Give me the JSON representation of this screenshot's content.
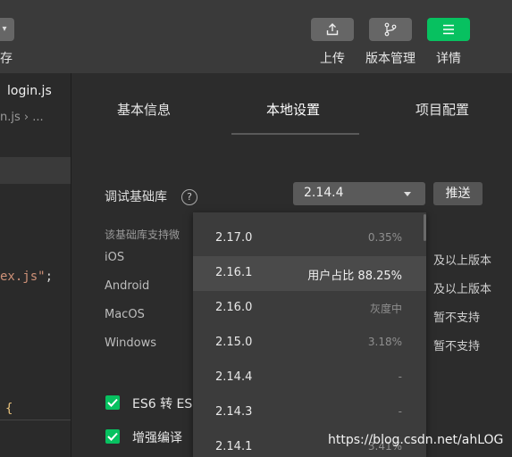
{
  "toolbar": {
    "left_button_label": "",
    "left_label": "存",
    "upload_label": "上传",
    "version_mgmt_label": "版本管理",
    "details_label": "详情",
    "accent_color": "#07c160"
  },
  "editor": {
    "tab_name": "login.js",
    "breadcrumb": "n.js  ›  ...",
    "code_line": "ex.js\"",
    "code_semicolon": ";",
    "brace": "{"
  },
  "tabs": [
    {
      "label": "基本信息"
    },
    {
      "label": "本地设置"
    },
    {
      "label": "项目配置"
    }
  ],
  "debug_lib": {
    "label": "调试基础库",
    "help": "?",
    "selected_version": "2.14.4",
    "push_button": "推送",
    "support_text": "该基础库支持微"
  },
  "os_rows": [
    {
      "name": "iOS",
      "status": "及以上版本"
    },
    {
      "name": "Android",
      "status": "及以上版本"
    },
    {
      "name": "MacOS",
      "status": "暂不支持"
    },
    {
      "name": "Windows",
      "status": "暂不支持"
    }
  ],
  "checkboxes": [
    {
      "label": "ES6 转 ES",
      "checked": true
    },
    {
      "label": "增强编译",
      "checked": true
    }
  ],
  "dropdown": {
    "items": [
      {
        "version": "2.17.0",
        "share": "0.35%"
      },
      {
        "version": "2.16.1",
        "share": "用户占比  88.25%"
      },
      {
        "version": "2.16.0",
        "share": "灰度中"
      },
      {
        "version": "2.15.0",
        "share": "3.18%"
      },
      {
        "version": "2.14.4",
        "share": "-"
      },
      {
        "version": "2.14.3",
        "share": "-"
      },
      {
        "version": "2.14.1",
        "share": "3.41%"
      }
    ]
  },
  "watermark": "https://blog.csdn.net/ahLOG"
}
